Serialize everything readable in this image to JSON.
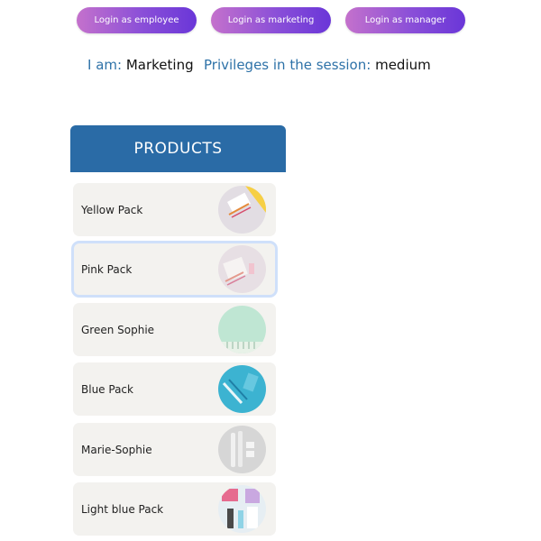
{
  "login_buttons": {
    "employee": "Login as employee",
    "marketing": "Login as marketing",
    "manager": "Login as manager"
  },
  "session": {
    "role_label": "I am:",
    "role_value": "Marketing",
    "privileges_label": "Privileges in the session:",
    "privileges_value": "medium"
  },
  "products": {
    "header": "PRODUCTS",
    "items": [
      {
        "label": "Yellow Pack",
        "selected": false
      },
      {
        "label": "Pink Pack",
        "selected": true
      },
      {
        "label": "Green Sophie",
        "selected": false
      },
      {
        "label": "Blue Pack",
        "selected": false
      },
      {
        "label": "Marie-Sophie",
        "selected": false
      },
      {
        "label": "Light blue Pack",
        "selected": false
      }
    ]
  },
  "colors": {
    "button_gradient_start": "#c471cc",
    "button_gradient_end": "#6a36d8",
    "header_blue": "#2a6ba6",
    "label_blue": "#2e72a8",
    "card_bg": "#f3f2ef"
  }
}
